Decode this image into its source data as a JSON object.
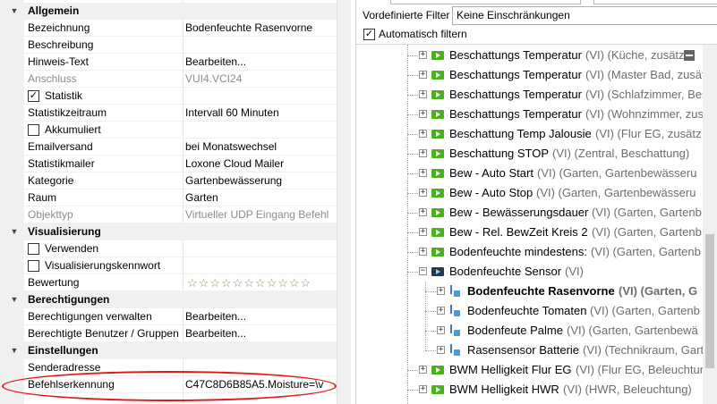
{
  "properties": {
    "categories": {
      "allgemein": "Allgemein",
      "visualisierung": "Visualisierung",
      "berechtigungen": "Berechtigungen",
      "einstellungen": "Einstellungen"
    },
    "rows": {
      "bezeichnung": {
        "label": "Bezeichnung",
        "value": "Bodenfeuchte Rasenvorne"
      },
      "beschreibung": {
        "label": "Beschreibung",
        "value": ""
      },
      "hinweis": {
        "label": "Hinweis-Text",
        "value": "Bearbeiten..."
      },
      "anschluss": {
        "label": "Anschluss",
        "value": "VUI4.VCI24"
      },
      "statistik": {
        "label": "Statistik",
        "checked": true
      },
      "statistikzeitraum": {
        "label": "Statistikzeitraum",
        "value": "Intervall 60 Minuten"
      },
      "akkumuliert": {
        "label": "Akkumuliert",
        "checked": false
      },
      "emailversand": {
        "label": "Emailversand",
        "value": "bei Monatswechsel"
      },
      "statistikmailer": {
        "label": "Statistikmailer",
        "value": "Loxone Cloud Mailer"
      },
      "kategorie": {
        "label": "Kategorie",
        "value": "Gartenbewässerung"
      },
      "raum": {
        "label": "Raum",
        "value": "Garten"
      },
      "objekttyp": {
        "label": "Objekttyp",
        "value": "Virtueller UDP Eingang Befehl"
      },
      "verwenden": {
        "label": "Verwenden",
        "checked": false
      },
      "viskennwort": {
        "label": "Visualisierungskennwort",
        "checked": false
      },
      "bewertung": {
        "label": "Bewertung",
        "stars": "☆☆☆☆☆☆☆☆☆☆☆",
        "rating": 0
      },
      "berechtigungen_verwalten": {
        "label": "Berechtigungen verwalten",
        "value": "Bearbeiten..."
      },
      "berechtigte_benutzer": {
        "label": "Berechtigte Benutzer / Gruppen",
        "value": "Bearbeiten..."
      },
      "senderadresse": {
        "label": "Senderadresse",
        "value": ""
      },
      "befehlserkennung": {
        "label": "Befehlserkennung",
        "value": "C47C8D6B85A5.Moisture=\\v"
      }
    },
    "highlight_color": "#e01818"
  },
  "filter": {
    "label": "Vordefinierte Filter",
    "selected": "Keine Einschränkungen",
    "auto_label": "Automatisch filtern",
    "auto_checked": true
  },
  "tree": [
    {
      "name": "Beschattungs Temperatur",
      "desc": "(VI) (Küche, zusätz"
    },
    {
      "name": "Beschattungs Temperatur",
      "desc": "(VI) (Master Bad, zusätz"
    },
    {
      "name": "Beschattungs Temperatur",
      "desc": "(VI) (Schlafzimmer, Bes"
    },
    {
      "name": "Beschattungs Temperatur",
      "desc": "(VI) (Wohnzimmer, zusä"
    },
    {
      "name": "Beschattung Temp Jalousie",
      "desc": "(VI) (Flur EG, zusätz"
    },
    {
      "name": "Beschattung STOP",
      "desc": "(VI) (Zentral, Beschattung)"
    },
    {
      "name": "Bew - Auto Start",
      "desc": "(VI) (Garten, Gartenbewässeru"
    },
    {
      "name": "Bew - Auto Stop",
      "desc": "(VI) (Garten, Gartenbewässeru"
    },
    {
      "name": "Bew - Bewässerungsdauer",
      "desc": "(VI) (Garten, Gartenb"
    },
    {
      "name": "Bew - Rel. BewZeit Kreis 2",
      "desc": "(VI) (Garten, Gartenb"
    },
    {
      "name": "Bodenfeuchte mindestens:",
      "desc": "(VI) (Garten, Gartenb"
    },
    {
      "name": "Bodenfeuchte Sensor",
      "desc": "(VI)"
    },
    {
      "name": "Bodenfeuchte Rasenvorne",
      "desc": "(VI) (Garten, G"
    },
    {
      "name": "Bodenfeuchte Tomaten",
      "desc": "(VI) (Garten, Gartenb"
    },
    {
      "name": "Bodenfeute Palme",
      "desc": "(VI) (Garten, Gartenbewä"
    },
    {
      "name": "Rasensensor Batterie",
      "desc": "(VI) (Technikraum, Gart"
    },
    {
      "name": "BWM Helligkeit Flur EG",
      "desc": "(VI) (Flur EG, Beleuchtur"
    },
    {
      "name": "BWM Helligkeit HWR",
      "desc": "(VI) (HWR, Beleuchtung)"
    }
  ],
  "icons": {
    "folder_expand": "plus-box",
    "folder_collapse": "minus-box",
    "virtual_input": "green-arrow-icon",
    "virtual_input_selected_folder": "dark-arrow-icon",
    "sensor_command": "sensor-icon"
  }
}
